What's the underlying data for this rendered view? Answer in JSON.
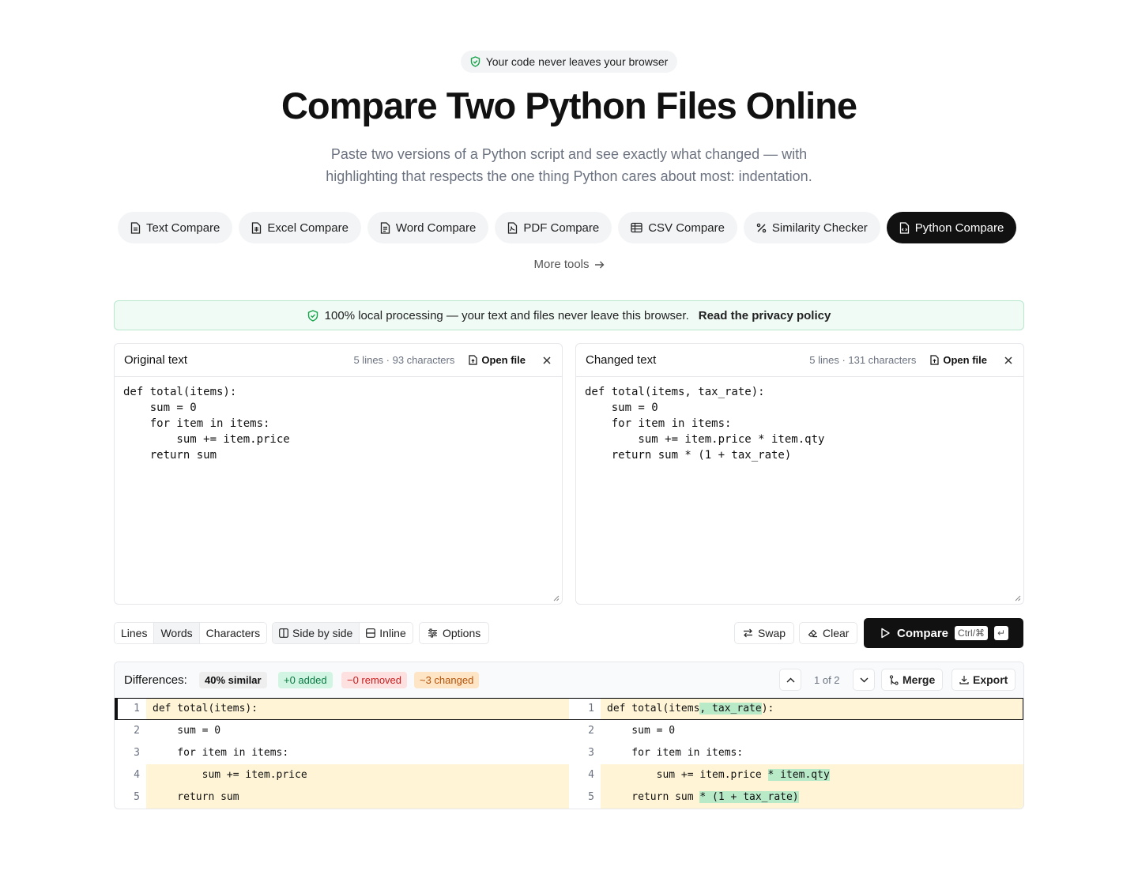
{
  "badge": {
    "text": "Your code never leaves your browser",
    "icon": "shield-check-icon"
  },
  "hero": {
    "title": "Compare Two Python Files Online",
    "subtitle_line1": "Paste two versions of a Python script and see exactly what changed — with",
    "subtitle_line2": "highlighting that respects the one thing Python cares about most: indentation."
  },
  "tools": [
    {
      "label": "Text Compare",
      "icon": "file-text-icon"
    },
    {
      "label": "Excel Compare",
      "icon": "file-spreadsheet-icon"
    },
    {
      "label": "Word Compare",
      "icon": "file-word-icon"
    },
    {
      "label": "PDF Compare",
      "icon": "file-pdf-icon"
    },
    {
      "label": "CSV Compare",
      "icon": "table-icon"
    },
    {
      "label": "Similarity Checker",
      "icon": "percent-icon"
    },
    {
      "label": "Python Compare",
      "icon": "file-code-icon",
      "active": true
    }
  ],
  "more_tools": "More tools",
  "privacy": {
    "text": "100% local processing — your text and files never leave this browser.",
    "link": "Read the privacy policy"
  },
  "original": {
    "title": "Original text",
    "meta": "5 lines · 93 characters",
    "open_file": "Open file",
    "code": "def total(items):\n    sum = 0\n    for item in items:\n        sum += item.price\n    return sum"
  },
  "changed": {
    "title": "Changed text",
    "meta": "5 lines · 131 characters",
    "open_file": "Open file",
    "code": "def total(items, tax_rate):\n    sum = 0\n    for item in items:\n        sum += item.price * item.qty\n    return sum * (1 + tax_rate)"
  },
  "toolbar": {
    "granularity": [
      "Lines",
      "Words",
      "Characters"
    ],
    "granularity_selected": "Words",
    "view_side": "Side by side",
    "view_inline": "Inline",
    "view_selected": "Side by side",
    "options": "Options",
    "swap": "Swap",
    "clear": "Clear",
    "compare": "Compare",
    "compare_kbd": "Ctrl/⌘",
    "compare_enter": "↵"
  },
  "diff": {
    "label": "Differences:",
    "similar": "40% similar",
    "added": "+0 added",
    "removed": "−0 removed",
    "changed": "~3 changed",
    "pager": "1 of 2",
    "merge": "Merge",
    "export": "Export",
    "left_rows": [
      {
        "num": "1",
        "parts": [
          {
            "t": "def total(items):"
          }
        ],
        "changed": true
      },
      {
        "num": "2",
        "parts": [
          {
            "t": "    sum = 0"
          }
        ],
        "changed": false
      },
      {
        "num": "3",
        "parts": [
          {
            "t": "    for item in items:"
          }
        ],
        "changed": false
      },
      {
        "num": "4",
        "parts": [
          {
            "t": "        sum += item.price"
          }
        ],
        "changed": true
      },
      {
        "num": "5",
        "parts": [
          {
            "t": "    return sum"
          }
        ],
        "changed": true
      }
    ],
    "right_rows": [
      {
        "num": "1",
        "parts": [
          {
            "t": "def total(items"
          },
          {
            "t": ", tax_rate",
            "ins": true
          },
          {
            "t": "):"
          }
        ],
        "changed": true
      },
      {
        "num": "2",
        "parts": [
          {
            "t": "    sum = 0"
          }
        ],
        "changed": false
      },
      {
        "num": "3",
        "parts": [
          {
            "t": "    for item in items:"
          }
        ],
        "changed": false
      },
      {
        "num": "4",
        "parts": [
          {
            "t": "        sum += item.price "
          },
          {
            "t": "* item.qty",
            "ins": true
          }
        ],
        "changed": true
      },
      {
        "num": "5",
        "parts": [
          {
            "t": "    return sum "
          },
          {
            "t": "* (1 + tax_rate)",
            "ins": true
          }
        ],
        "changed": true
      }
    ]
  }
}
